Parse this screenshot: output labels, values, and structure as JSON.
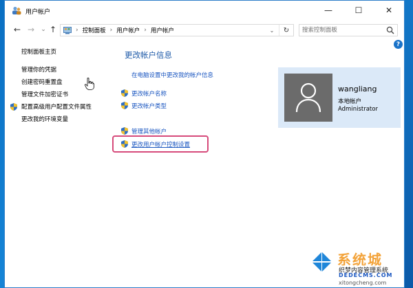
{
  "window": {
    "title": "用户帐户",
    "minimize": "—",
    "maximize": "☐",
    "close": "✕"
  },
  "nav": {
    "back": "←",
    "forward": "→",
    "recent": "⌄",
    "up": "↑",
    "breadcrumbs": [
      "控制面板",
      "用户帐户",
      "用户帐户"
    ],
    "breadcrumb_sep": "›",
    "dropdown": "⌄",
    "refresh": "↻",
    "search_placeholder": "搜索控制面板"
  },
  "help": "?",
  "sidebar": {
    "items": [
      {
        "label": "控制面板主页",
        "shield": false
      },
      {
        "label": "管理你的凭据",
        "shield": false
      },
      {
        "label": "创建密码重置盘",
        "shield": false
      },
      {
        "label": "管理文件加密证书",
        "shield": false
      },
      {
        "label": "配置高级用户配置文件属性",
        "shield": true
      },
      {
        "label": "更改我的环境变量",
        "shield": false
      }
    ]
  },
  "main": {
    "heading": "更改帐户信息",
    "pc_settings_link": "在电脑设置中更改我的帐户信息",
    "change_name": "更改帐户名称",
    "change_type": "更改帐户类型",
    "manage_other": "管理其他帐户",
    "uac_settings": "更改用户帐户控制设置"
  },
  "user": {
    "name": "wangliang",
    "type": "本地帐户",
    "role": "Administrator"
  },
  "watermark": {
    "big": "系统城",
    "line1": "织梦内容管理系统",
    "line2": "DEDECMS.COM",
    "line3": "xitongcheng.com"
  },
  "colors": {
    "link": "#1a56c0",
    "heading": "#1e5aa8",
    "highlight_border": "#d64a7a",
    "user_card_bg": "#dbe9f8",
    "avatar_bg": "#6b6b6b"
  }
}
